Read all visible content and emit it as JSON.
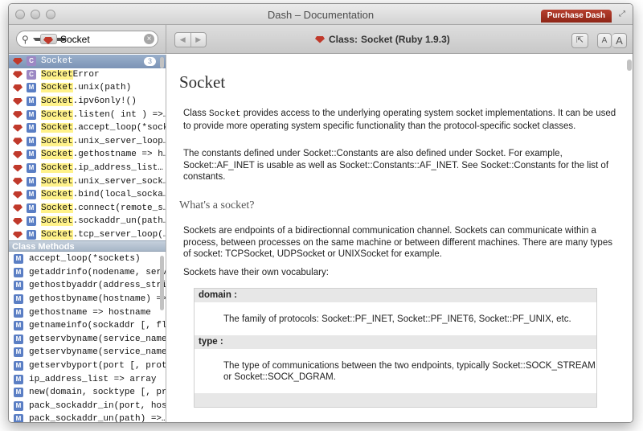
{
  "window": {
    "title": "Dash – Documentation",
    "purchase_label": "Purchase Dash"
  },
  "toolbar": {
    "search_value": "Socket",
    "back_glyph": "◀",
    "forward_glyph": "▶",
    "doc_title_prefix": "Class:",
    "doc_title_name": "Socket (Ruby 1.9.3)",
    "font_small": "A",
    "font_large": "A"
  },
  "results": [
    {
      "type": "C",
      "hl": "Socket",
      "rest": "",
      "selected": true,
      "count": "3"
    },
    {
      "type": "C",
      "hl": "Socket",
      "rest": "Error"
    },
    {
      "type": "M",
      "hl": "Socket",
      "rest": ".unix(path)"
    },
    {
      "type": "M",
      "hl": "Socket",
      "rest": ".ipv6only!()"
    },
    {
      "type": "M",
      "hl": "Socket",
      "rest": ".listen( int ) =>…"
    },
    {
      "type": "M",
      "hl": "Socket",
      "rest": ".accept_loop(*sock…"
    },
    {
      "type": "M",
      "hl": "Socket",
      "rest": ".unix_server_loop…"
    },
    {
      "type": "M",
      "hl": "Socket",
      "rest": ".gethostname => h…"
    },
    {
      "type": "M",
      "hl": "Socket",
      "rest": ".ip_address_list…"
    },
    {
      "type": "M",
      "hl": "Socket",
      "rest": ".unix_server_sock…"
    },
    {
      "type": "M",
      "hl": "Socket",
      "rest": ".bind(local_socka…"
    },
    {
      "type": "M",
      "hl": "Socket",
      "rest": ".connect(remote_s…"
    },
    {
      "type": "M",
      "hl": "Socket",
      "rest": ".sockaddr_un(path…"
    },
    {
      "type": "M",
      "hl": "Socket",
      "rest": ".tcp_server_loop(…"
    }
  ],
  "class_methods": {
    "header": "Class Methods",
    "items": [
      "accept_loop(*sockets)",
      "getaddrinfo(nodename, serv…",
      "gethostbyaddr(address_stri…",
      "gethostbyname(hostname) =>…",
      "gethostname => hostname",
      "getnameinfo(sockaddr [, fl…",
      "getservbyname(service_name…",
      "getservbyname(service_name…",
      "getservbyport(port [, prot…",
      "ip_address_list => array",
      "new(domain, socktype [, pr…",
      "pack_sockaddr_in(port, hos…",
      "pack_sockaddr_un(path) =>…"
    ]
  },
  "doc": {
    "heading": "Socket",
    "p1_a": "Class ",
    "p1_code": "Socket",
    "p1_b": " provides access to the underlying operating system socket implementations. It can be used to provide more operating system specific functionality than the protocol-specific socket classes.",
    "p2": "The constants defined under Socket::Constants are also defined under Socket. For example, Socket::AF_INET is usable as well as Socket::Constants::AF_INET. See Socket::Constants for the list of constants.",
    "h2": "What's a socket?",
    "p3": "Sockets are endpoints of a bidirectionnal communication channel. Sockets can communicate within a process, between processes on the same machine or between different machines. There are many types of socket: TCPSocket, UDPSocket or UNIXSocket for example.",
    "p4": "Sockets have their own vocabulary:",
    "defs": [
      {
        "term": "domain :",
        "desc": "The family of protocols: Socket::PF_INET, Socket::PF_INET6, Socket::PF_UNIX, etc."
      },
      {
        "term": "type :",
        "desc": "The type of communications between the two endpoints, typically Socket::SOCK_STREAM or Socket::SOCK_DGRAM."
      }
    ]
  }
}
